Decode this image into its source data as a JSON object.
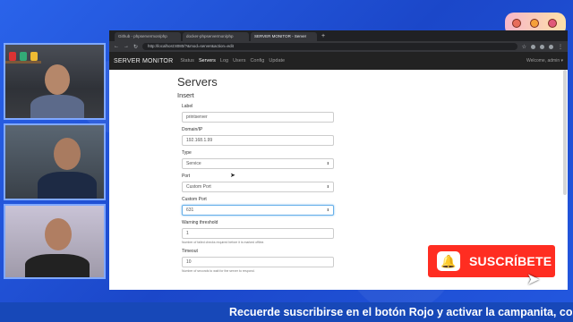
{
  "browser": {
    "tabs": [
      {
        "label": "Github - phpservermon/php"
      },
      {
        "label": "docker-phpservermon/php"
      },
      {
        "label": "SERVER MONITOR - Server"
      }
    ],
    "new_tab": "+",
    "url": "http://localhost:8080/?&mod=server&action=edit"
  },
  "app": {
    "brand": "SERVER MONITOR",
    "nav": [
      "Status",
      "Servers",
      "Log",
      "Users",
      "Config",
      "Update"
    ],
    "active_nav": "Servers",
    "welcome": "Welcome, admin ▾"
  },
  "page": {
    "title": "Servers",
    "section": "Insert"
  },
  "form": {
    "label_label": "Label",
    "label_value": "printserver",
    "domain_label": "Domain/IP",
    "domain_value": "192.168.1.99",
    "type_label": "Type",
    "type_value": "Service",
    "port_label": "Port",
    "port_value": "Custom Port",
    "custom_port_label": "Custom Port",
    "custom_port_value": "631",
    "warning_label": "Warning threshold",
    "warning_value": "1",
    "warning_help": "Number of failed checks required before it is marked offline.",
    "timeout_label": "Timeout",
    "timeout_value": "10",
    "timeout_help": "Number of seconds to wait for the server to respond."
  },
  "overlay": {
    "subscribe_label": "SUSCRÍBETE",
    "ticker": "Recuerde suscribirse en el botón Rojo y activar la campanita, co"
  },
  "colors": {
    "background": "#1e4fd8",
    "subscribe": "#ff2d21",
    "navbar": "#222222"
  }
}
